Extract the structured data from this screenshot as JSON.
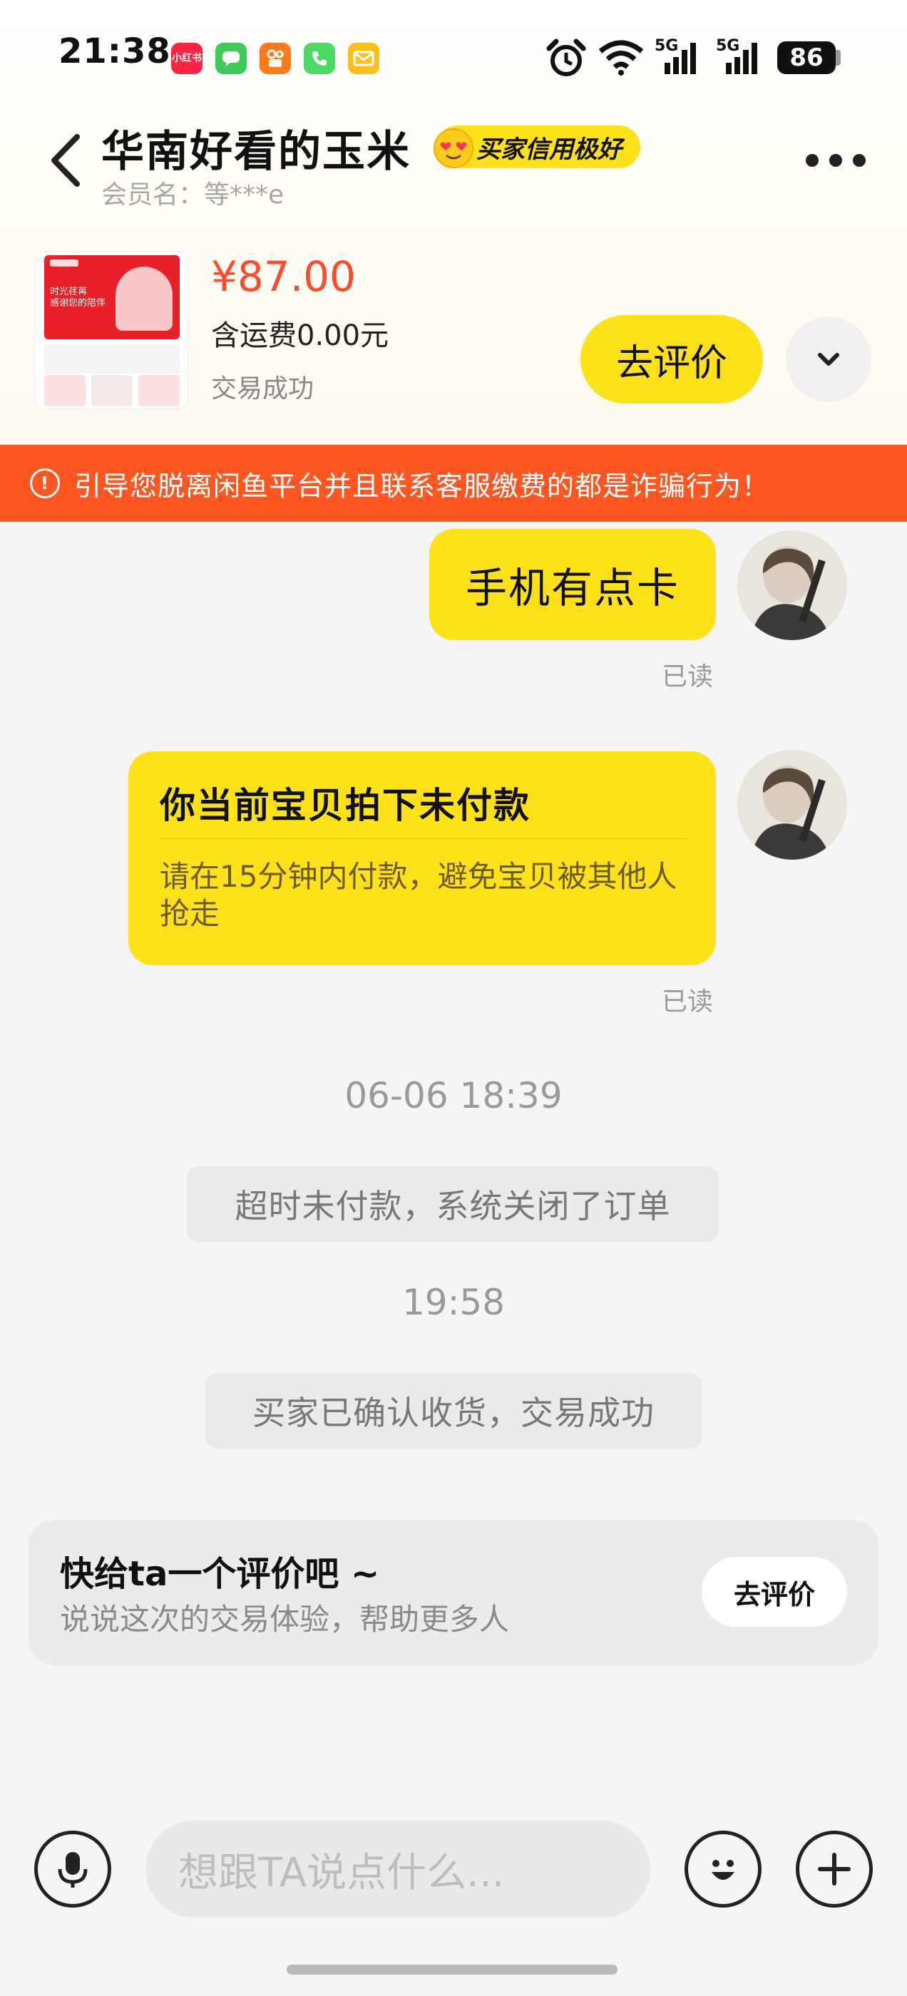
{
  "status_bar": {
    "time": "21:38",
    "notification_icons": [
      "xiaohongshu-icon",
      "messages-icon",
      "kuaishou-icon",
      "phone-icon",
      "mail-icon"
    ],
    "notification_label": "小红书",
    "network_1": "5G",
    "network_2": "5G",
    "battery": "86"
  },
  "nav": {
    "chat_name": "华南好看的玉米",
    "credit_badge": "买家信用极好",
    "member_prefix": "会员名：",
    "member_name": "等***e"
  },
  "product": {
    "price": "¥87.00",
    "shipping": "含运费0.00元",
    "status": "交易成功",
    "review_button": "去评价",
    "thumb_text": "时光荏苒\n感谢您的陪伴"
  },
  "warning": {
    "text": "引导您脱离闲鱼平台并且联系客服缴费的都是诈骗行为！"
  },
  "messages": {
    "msg1_text": "手机有点卡",
    "msg1_status": "已读",
    "order_card_title": "你当前宝贝拍下未付款",
    "order_card_desc": "请在15分钟内付款，避免宝贝被其他人抢走",
    "msg2_status": "已读",
    "timestamp1": "06-06 18:39",
    "system1": "超时未付款，系统关闭了订单",
    "timestamp2": "19:58",
    "system2": "买家已确认收货，交易成功"
  },
  "review_prompt": {
    "title": "快给ta一个评价吧 ~",
    "subtitle": "说说这次的交易体验，帮助更多人",
    "button": "去评价"
  },
  "input_bar": {
    "placeholder": "想跟TA说点什么..."
  },
  "colors": {
    "accent_yellow": "#ffe11a",
    "warning_orange": "#ff5722",
    "price_red": "#ff4b2b"
  }
}
